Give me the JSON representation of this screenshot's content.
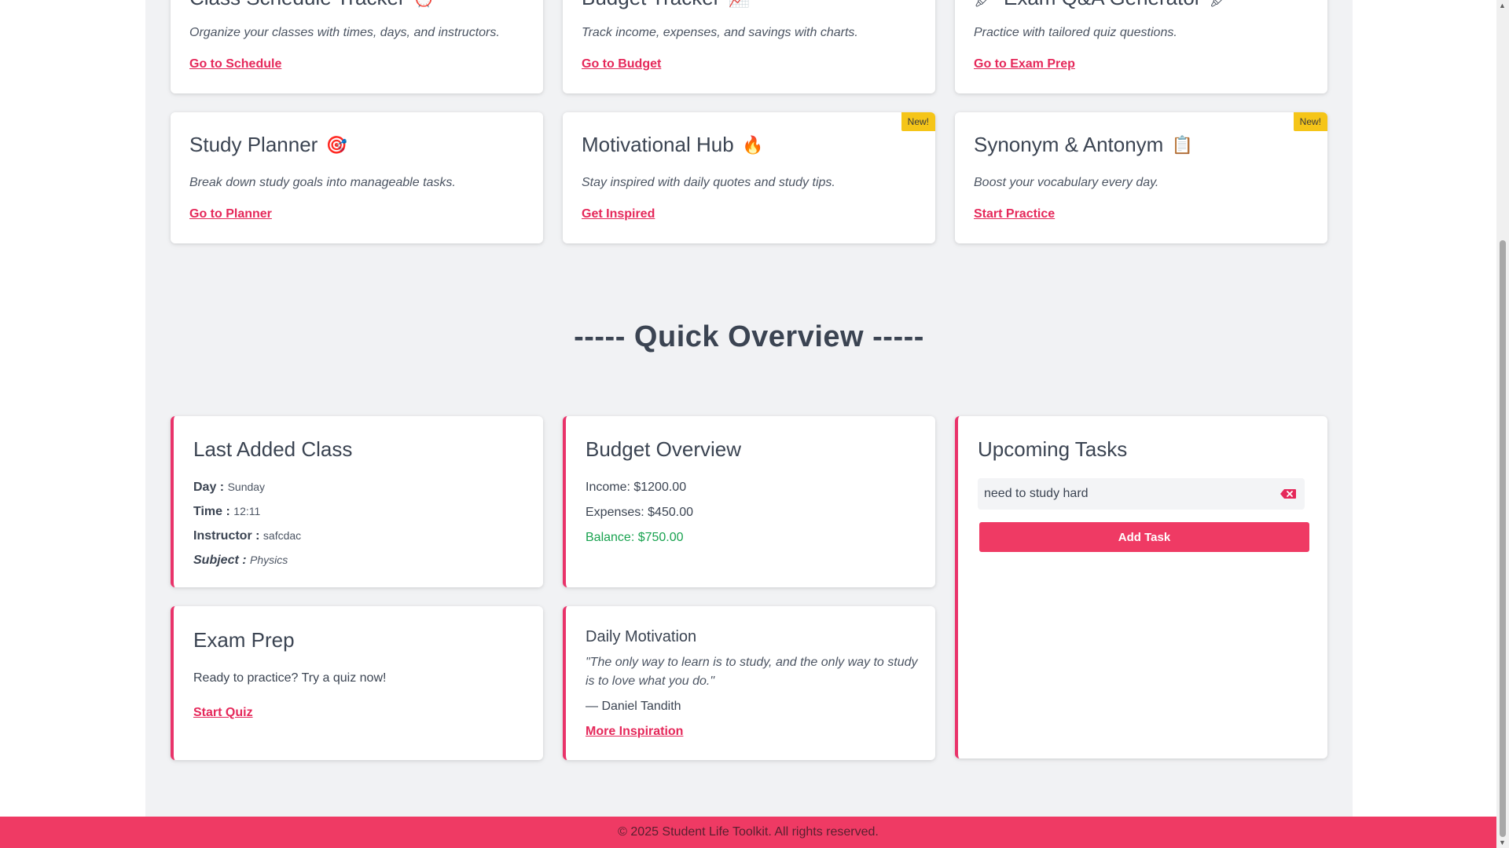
{
  "tools_row1": [
    {
      "title": "Class Schedule Tracker",
      "icon": "alarm-clock-emoji",
      "glyph": "⏰",
      "desc": "Organize your classes with times, days, and instructors.",
      "link": "Go to Schedule"
    },
    {
      "title": "Budget Tracker",
      "icon": "chart-emoji",
      "glyph": "📈",
      "desc": "Track income, expenses, and savings with charts.",
      "link": "Go to Budget"
    },
    {
      "title": "Exam Q&A Generator",
      "icon": "pen-emoji",
      "glyph": "🖍",
      "desc": "Practice with tailored quiz questions.",
      "link": "Go to Exam Prep"
    }
  ],
  "tools_row2": [
    {
      "title": "Study Planner",
      "icon": "target-emoji",
      "glyph": "🎯",
      "desc": "Break down study goals into manageable tasks.",
      "link": "Go to Planner",
      "badge": ""
    },
    {
      "title": "Motivational Hub",
      "icon": "fire-emoji",
      "glyph": "🔥",
      "desc": "Stay inspired with daily quotes and study tips.",
      "link": "Get Inspired",
      "badge": "New!"
    },
    {
      "title": "Synonym & Antonym",
      "icon": "clipboard-emoji",
      "glyph": "📋",
      "desc": "Boost your vocabulary every day.",
      "link": "Start Practice",
      "badge": "New!"
    }
  ],
  "overview": {
    "title": "----- Quick Overview -----",
    "last_class": {
      "heading": "Last Added Class",
      "day_label": "Day :",
      "day": "Sunday",
      "time_label": "Time :",
      "time": "12:11",
      "instructor_label": "Instructor :",
      "instructor": "safcdac",
      "subject_label": "Subject :",
      "subject": "Physics"
    },
    "budget": {
      "heading": "Budget Overview",
      "income": "Income: $1200.00",
      "expenses": "Expenses: $450.00",
      "balance": "Balance: $750.00"
    },
    "tasks": {
      "heading": "Upcoming Tasks",
      "input_value": "need to study hard",
      "add_label": "Add Task"
    },
    "exam": {
      "heading": "Exam Prep",
      "text": "Ready to practice? Try a quiz now!",
      "link": "Start Quiz"
    },
    "motivation": {
      "heading": "Daily Motivation",
      "quote_line1": "\"The only way to learn is to study, and the only way to study",
      "quote_line2": "is to love what you do.\"",
      "author": "— Daniel Tandith",
      "link": "More Inspiration"
    }
  },
  "footer": "© 2025 Student Life Toolkit. All rights reserved.",
  "colors": {
    "accent": "#ef3a64",
    "link": "#e5285a",
    "badge": "#f5c518",
    "positive": "#18a24f"
  }
}
